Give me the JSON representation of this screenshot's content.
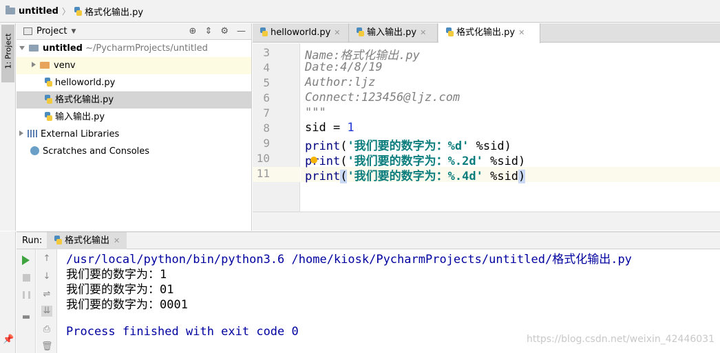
{
  "breadcrumb": {
    "project": "untitled",
    "file": "格式化输出.py"
  },
  "left_stripe": {
    "project_tab": "1: Project"
  },
  "project_panel": {
    "title": "Project",
    "tree": [
      {
        "label": "untitled",
        "suffix": "~/PycharmProjects/untitled"
      },
      {
        "label": "venv"
      },
      {
        "label": "helloworld.py"
      },
      {
        "label": "格式化输出.py"
      },
      {
        "label": "输入输出.py"
      },
      {
        "label": "External Libraries"
      },
      {
        "label": "Scratches and Consoles"
      }
    ]
  },
  "editor": {
    "tabs": [
      {
        "label": "helloworld.py"
      },
      {
        "label": "输入输出.py"
      },
      {
        "label": "格式化输出.py"
      }
    ],
    "lines": [
      {
        "n": "3",
        "text": "Name:格式化输出.py"
      },
      {
        "n": "4",
        "text": "Date:4/8/19"
      },
      {
        "n": "5",
        "text": "Author:ljz"
      },
      {
        "n": "6",
        "text": "Connect:123456@ljz.com"
      },
      {
        "n": "7",
        "text": "\"\"\""
      },
      {
        "n": "8",
        "var": "sid = ",
        "num": "1"
      },
      {
        "n": "9",
        "fn": "print",
        "open": "(",
        "str": "'我们要的数字为：%d'",
        "rest": " %sid)"
      },
      {
        "n": "10",
        "fn": "print",
        "open": "(",
        "str": "'我们要的数字为：%.2d'",
        "rest": " %sid)"
      },
      {
        "n": "11",
        "fn": "print",
        "open": "(",
        "str": "'我们要的数字为：%.4d'",
        "rest": " %sid",
        "close": ")"
      }
    ]
  },
  "run": {
    "label": "Run:",
    "tab": "格式化输出",
    "output": [
      "/usr/local/python/bin/python3.6 /home/kiosk/PycharmProjects/untitled/格式化输出.py",
      "我们要的数字为：1",
      "我们要的数字为：01",
      "我们要的数字为：0001",
      "",
      "Process finished with exit code 0"
    ],
    "watermark": "https://blog.csdn.net/weixin_42446031"
  }
}
